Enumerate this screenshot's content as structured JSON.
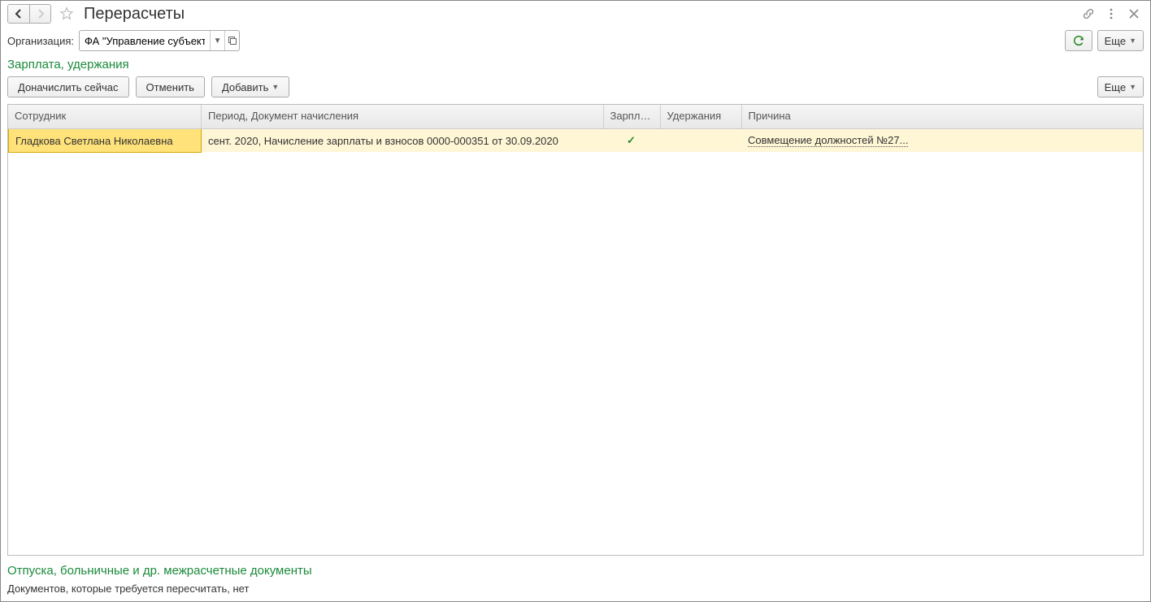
{
  "header": {
    "title": "Перерасчеты"
  },
  "filter": {
    "label": "Организация:",
    "value": "ФА \"Управление субъекта",
    "more_label": "Еще"
  },
  "section1": {
    "title": "Зарплата, удержания",
    "buttons": {
      "recalc": "Доначислить сейчас",
      "cancel": "Отменить",
      "add": "Добавить"
    },
    "more_label": "Еще",
    "columns": {
      "employee": "Сотрудник",
      "period": "Период, Документ начисления",
      "salary": "Зарплата",
      "deductions": "Удержания",
      "reason": "Причина"
    },
    "rows": [
      {
        "employee": "Гладкова Светлана Николаевна",
        "period": "сент. 2020, Начисление зарплаты и взносов 0000-000351 от 30.09.2020",
        "salary_check": true,
        "deductions": "",
        "reason": "Совмещение должностей №27..."
      }
    ]
  },
  "section2": {
    "title": "Отпуска, больничные и др. межрасчетные документы",
    "empty_text": "Документов, которые требуется пересчитать, нет"
  }
}
